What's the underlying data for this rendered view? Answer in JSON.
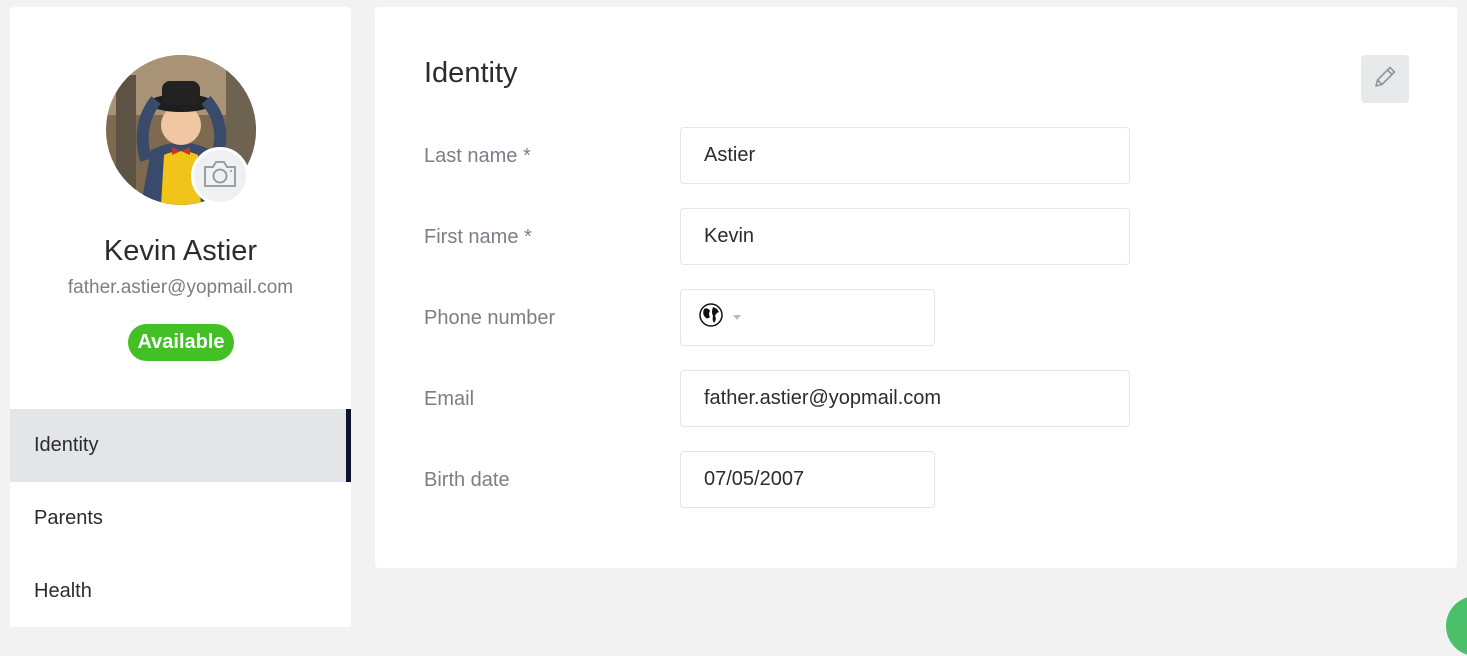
{
  "profile": {
    "name": "Kevin Astier",
    "email": "father.astier@yopmail.com",
    "status": "Available"
  },
  "nav": {
    "items": [
      {
        "label": "Identity",
        "active": true
      },
      {
        "label": "Parents",
        "active": false
      },
      {
        "label": "Health",
        "active": false
      }
    ]
  },
  "identity": {
    "title": "Identity",
    "fields": {
      "last_name": {
        "label": "Last name *",
        "value": "Astier"
      },
      "first_name": {
        "label": "First name *",
        "value": "Kevin"
      },
      "phone": {
        "label": "Phone number",
        "value": "",
        "flag_icon": "globe-icon"
      },
      "email": {
        "label": "Email",
        "value": "father.astier@yopmail.com"
      },
      "birth_date": {
        "label": "Birth date",
        "value": "07/05/2007"
      }
    }
  },
  "colors": {
    "status_badge": "#43c026",
    "active_nav_indicator": "#0d1330",
    "fab": "#4cbf6a"
  }
}
